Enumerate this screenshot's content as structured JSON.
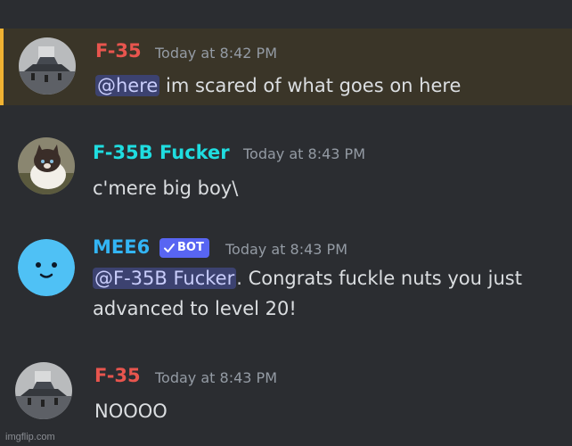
{
  "messages": [
    {
      "username": "F-35",
      "timestamp": "Today at 8:42 PM",
      "mention": "@here",
      "text": " im scared of what goes on here",
      "highlighted": true
    },
    {
      "username": "F-35B Fucker",
      "timestamp": "Today at 8:43 PM",
      "text": "c'mere big boy\\"
    },
    {
      "username": "MEE6",
      "badge": "BOT",
      "timestamp": "Today at 8:43 PM",
      "mention": "@F-35B Fucker",
      "text_line1": ". Congrats fuckle nuts you just",
      "text_line2": "advanced to level 20!"
    },
    {
      "username": "F-35",
      "timestamp": "Today at 8:43 PM",
      "text": "NOOOO"
    }
  ],
  "colors": {
    "background": "#2b2d31",
    "f35_name": "#e8554e",
    "f35b_name": "#1fdde0",
    "mee6_name": "#33b5f5",
    "mention_bg": "#3c4270",
    "highlight_border": "#f0b232",
    "bot_badge": "#5865f2"
  },
  "watermark": "imgflip.com"
}
